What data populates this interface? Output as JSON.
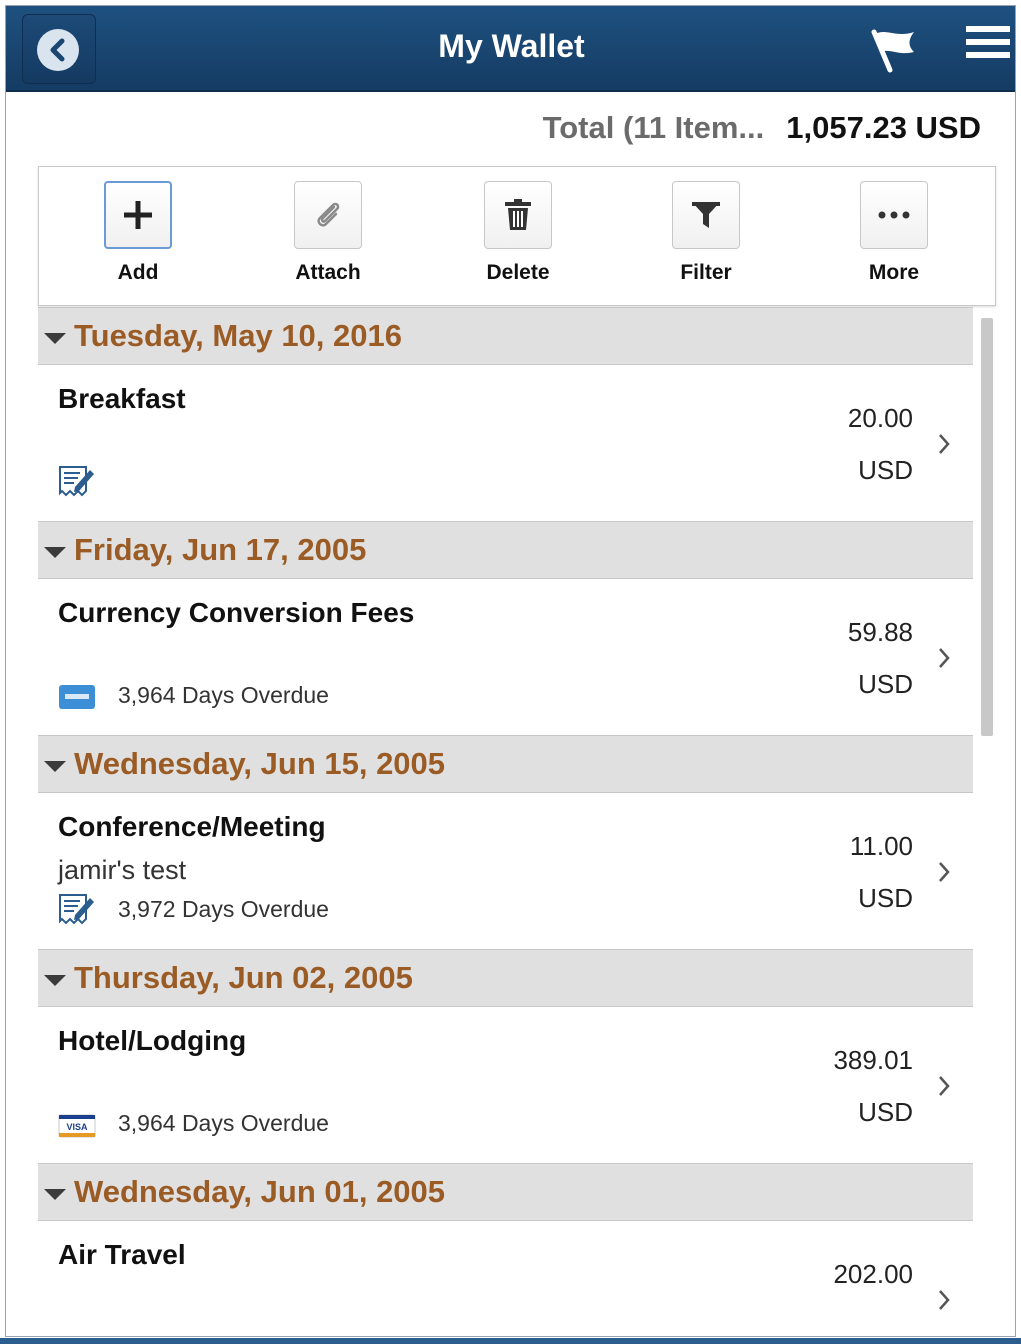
{
  "header": {
    "title": "My Wallet",
    "back_icon": "chevron-left-icon",
    "flag_icon": "flag-icon",
    "menu_icon": "hamburger-menu-icon"
  },
  "total": {
    "label": "Total (11 Item...",
    "value": "1,057.23 USD"
  },
  "toolbar": {
    "buttons": [
      {
        "label": "Add",
        "icon": "plus-icon"
      },
      {
        "label": "Attach",
        "icon": "paperclip-icon"
      },
      {
        "label": "Delete",
        "icon": "trash-icon"
      },
      {
        "label": "Filter",
        "icon": "filter-icon"
      },
      {
        "label": "More",
        "icon": "ellipsis-icon"
      }
    ]
  },
  "groups": [
    {
      "date": "Tuesday, May 10, 2016",
      "item": {
        "name": "Breakfast",
        "description": "",
        "icon": "receipt-edit-icon",
        "overdue": "",
        "amount": "20.00",
        "currency": "USD"
      }
    },
    {
      "date": "Friday, Jun 17, 2005",
      "item": {
        "name": "Currency Conversion Fees",
        "description": "",
        "icon": "amex-card-icon",
        "overdue": "3,964 Days Overdue",
        "amount": "59.88",
        "currency": "USD"
      }
    },
    {
      "date": "Wednesday, Jun 15, 2005",
      "item": {
        "name": "Conference/Meeting",
        "description": "jamir's test",
        "icon": "receipt-edit-icon",
        "overdue": "3,972 Days Overdue",
        "amount": "11.00",
        "currency": "USD"
      }
    },
    {
      "date": "Thursday, Jun 02, 2005",
      "item": {
        "name": "Hotel/Lodging",
        "description": "",
        "icon": "visa-card-icon",
        "overdue": "3,964 Days Overdue",
        "amount": "389.01",
        "currency": "USD"
      }
    },
    {
      "date": "Wednesday, Jun 01, 2005",
      "item": {
        "name": "Air Travel",
        "description": "",
        "icon": "",
        "overdue": "",
        "amount": "202.00",
        "currency": ""
      }
    }
  ],
  "colors": {
    "header_bg": "#1a4672",
    "date_text": "#9a5b24",
    "group_bg": "#e0e0e0"
  }
}
